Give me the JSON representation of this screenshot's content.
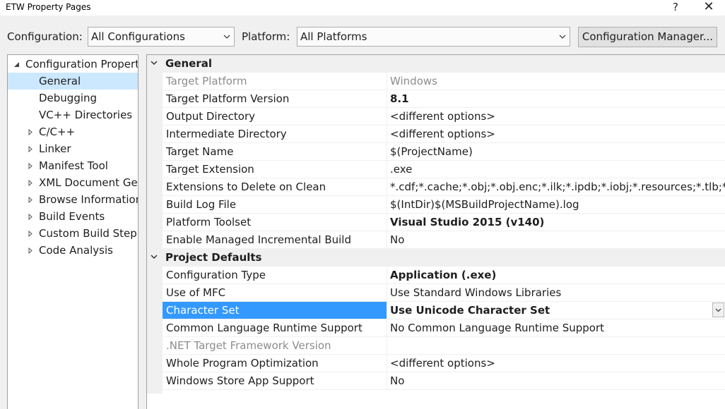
{
  "window": {
    "title": "ETW Property Pages",
    "help_glyph": "?",
    "close_glyph": "✕"
  },
  "toolbar": {
    "configuration_label": "Configuration:",
    "configuration_value": "All Configurations",
    "platform_label": "Platform:",
    "platform_value": "All Platforms",
    "config_manager_label": "Configuration Manager..."
  },
  "tree": {
    "root": "Configuration Properties",
    "items": [
      {
        "label": "General",
        "expandable": false
      },
      {
        "label": "Debugging",
        "expandable": false
      },
      {
        "label": "VC++ Directories",
        "expandable": false
      },
      {
        "label": "C/C++",
        "expandable": true
      },
      {
        "label": "Linker",
        "expandable": true
      },
      {
        "label": "Manifest Tool",
        "expandable": true
      },
      {
        "label": "XML Document Generator",
        "expandable": true
      },
      {
        "label": "Browse Information",
        "expandable": true
      },
      {
        "label": "Build Events",
        "expandable": true
      },
      {
        "label": "Custom Build Step",
        "expandable": true
      },
      {
        "label": "Code Analysis",
        "expandable": true
      }
    ],
    "selected": "General"
  },
  "grid": {
    "categories": [
      {
        "name": "General",
        "properties": [
          {
            "name": "Target Platform",
            "value": "Windows",
            "disabled": true
          },
          {
            "name": "Target Platform Version",
            "value": "8.1",
            "bold": true
          },
          {
            "name": "Output Directory",
            "value": "<different options>"
          },
          {
            "name": "Intermediate Directory",
            "value": "<different options>"
          },
          {
            "name": "Target Name",
            "value": "$(ProjectName)"
          },
          {
            "name": "Target Extension",
            "value": ".exe"
          },
          {
            "name": "Extensions to Delete on Clean",
            "value": "*.cdf;*.cache;*.obj;*.obj.enc;*.ilk;*.ipdb;*.iobj;*.resources;*.tlb;*.tli;*.tlh;"
          },
          {
            "name": "Build Log File",
            "value": "$(IntDir)$(MSBuildProjectName).log"
          },
          {
            "name": "Platform Toolset",
            "value": "Visual Studio 2015 (v140)",
            "bold": true
          },
          {
            "name": "Enable Managed Incremental Build",
            "value": "No"
          }
        ]
      },
      {
        "name": "Project Defaults",
        "properties": [
          {
            "name": "Configuration Type",
            "value": "Application (.exe)",
            "bold": true
          },
          {
            "name": "Use of MFC",
            "value": "Use Standard Windows Libraries"
          },
          {
            "name": "Character Set",
            "value": "Use Unicode Character Set",
            "bold": true,
            "selected": true
          },
          {
            "name": "Common Language Runtime Support",
            "value": "No Common Language Runtime Support"
          },
          {
            "name": ".NET Target Framework Version",
            "value": "",
            "disabled": true
          },
          {
            "name": "Whole Program Optimization",
            "value": "<different options>"
          },
          {
            "name": "Windows Store App Support",
            "value": "No"
          }
        ]
      }
    ]
  },
  "colors": {
    "selection_blue": "#3399ff",
    "tree_selection": "#cce8ff",
    "chrome": "#f0f0f0",
    "disabled_text": "#8c8c8c"
  }
}
